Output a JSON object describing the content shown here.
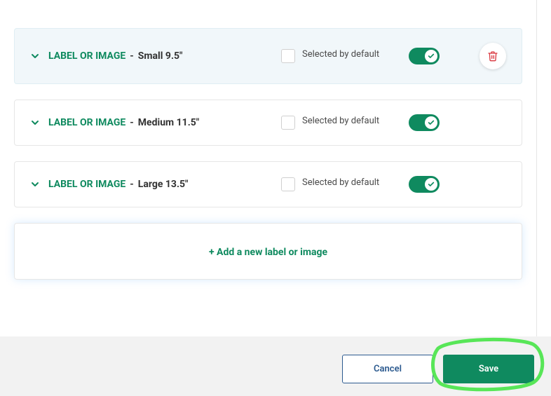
{
  "options": [
    {
      "prefix": "LABEL OR IMAGE",
      "name": "Small 9.5\"",
      "checkbox_label": "Selected by default",
      "toggle_on": true,
      "highlighted": true,
      "show_delete": true
    },
    {
      "prefix": "LABEL OR IMAGE",
      "name": "Medium 11.5\"",
      "checkbox_label": "Selected by default",
      "toggle_on": true,
      "highlighted": false,
      "show_delete": false
    },
    {
      "prefix": "LABEL OR IMAGE",
      "name": "Large 13.5\"",
      "checkbox_label": "Selected by default",
      "toggle_on": true,
      "highlighted": false,
      "show_delete": false
    }
  ],
  "add_button": {
    "label": "+ Add a new label or image"
  },
  "footer": {
    "cancel_label": "Cancel",
    "save_label": "Save"
  }
}
